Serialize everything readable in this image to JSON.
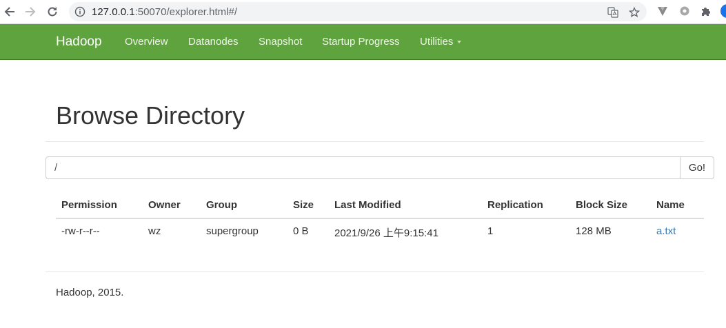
{
  "browser": {
    "url_host": "127.0.0.1",
    "url_rest": ":50070/explorer.html#/"
  },
  "navbar": {
    "brand": "Hadoop",
    "items": [
      {
        "label": "Overview"
      },
      {
        "label": "Datanodes"
      },
      {
        "label": "Snapshot"
      },
      {
        "label": "Startup Progress"
      },
      {
        "label": "Utilities"
      }
    ]
  },
  "page": {
    "title": "Browse Directory",
    "path_value": "/",
    "go_label": "Go!"
  },
  "table": {
    "headers": [
      "Permission",
      "Owner",
      "Group",
      "Size",
      "Last Modified",
      "Replication",
      "Block Size",
      "Name"
    ],
    "rows": [
      [
        "-rw-r--r--",
        "wz",
        "supergroup",
        "0 B",
        "2021/9/26 上午9:15:41",
        "1",
        "128 MB",
        "a.txt"
      ]
    ]
  },
  "footer": {
    "text": "Hadoop, 2015."
  },
  "colors": {
    "navbar_bg": "#5fa33e",
    "link": "#337ab7"
  },
  "icons": [
    "back-arrow-icon",
    "forward-arrow-icon",
    "reload-icon",
    "info-icon",
    "translate-icon",
    "star-icon",
    "extension-v-icon",
    "extension-gear-icon",
    "puzzle-icon",
    "profile-icon"
  ]
}
